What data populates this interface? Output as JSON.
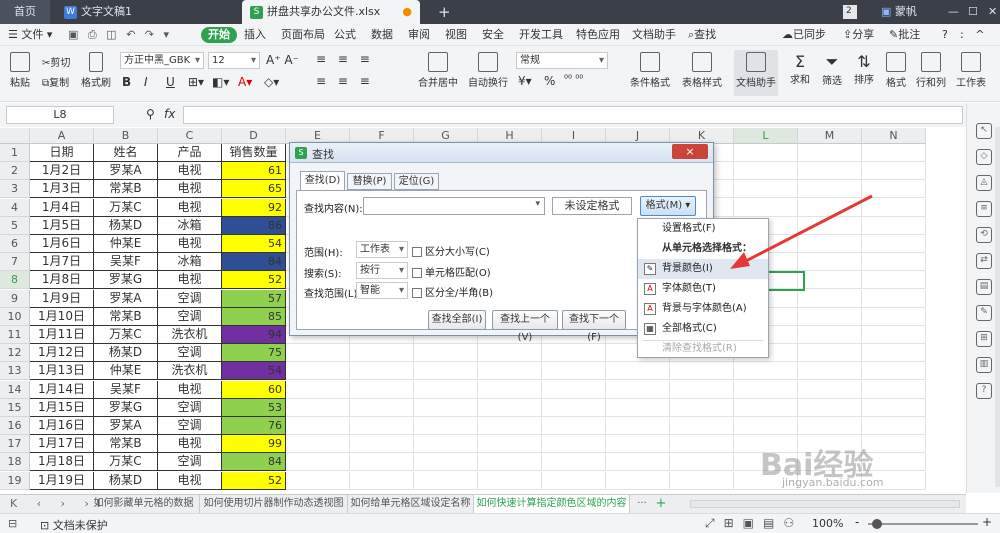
{
  "tabs": {
    "home": "首页",
    "doc1": "文字文稿1",
    "doc2": "拼盘共享办公文件.xlsx",
    "add": "+"
  },
  "topright": {
    "badge": "2",
    "user": "蒙帆"
  },
  "menu": {
    "file": "文件",
    "start": "开始",
    "items": [
      "插入",
      "页面布局",
      "公式",
      "数据",
      "审阅",
      "视图",
      "安全",
      "开发工具",
      "特色应用",
      "文档助手"
    ],
    "search": "查找",
    "sync": "已同步",
    "share": "分享",
    "comment": "批注",
    "help": "?"
  },
  "ribbon": {
    "paste": "粘贴",
    "cut": "剪切",
    "copy": "复制",
    "format_painter": "格式刷",
    "font": "方正中黑_GBK",
    "size": "12",
    "bold": "B",
    "italic": "I",
    "underline": "U",
    "merge": "合并居中",
    "wrap": "自动换行",
    "numfmt": "常规",
    "percent": "%",
    "cond": "条件格式",
    "table_style": "表格样式",
    "doc_helper": "文档助手",
    "sum": "求和",
    "filter": "筛选",
    "sort": "排序",
    "format": "格式",
    "rowcol": "行和列",
    "sheet": "工作表",
    "sigma": "Σ"
  },
  "formula": {
    "cell": "L8",
    "fx": "fx"
  },
  "columns": [
    "A",
    "B",
    "C",
    "D",
    "E",
    "F",
    "G",
    "H",
    "I",
    "J",
    "K",
    "L",
    "M",
    "N"
  ],
  "rows": [
    {
      "n": "1",
      "a": "日期",
      "b": "姓名",
      "c": "产品",
      "d": "销售数量",
      "color": "#ffffff"
    },
    {
      "n": "2",
      "a": "1月2日",
      "b": "罗某A",
      "c": "电视",
      "d": "61",
      "color": "#ffff00"
    },
    {
      "n": "3",
      "a": "1月3日",
      "b": "常某B",
      "c": "电视",
      "d": "65",
      "color": "#ffff00"
    },
    {
      "n": "4",
      "a": "1月4日",
      "b": "万某C",
      "c": "电视",
      "d": "92",
      "color": "#ffff00"
    },
    {
      "n": "5",
      "a": "1月5日",
      "b": "杨某D",
      "c": "冰箱",
      "d": "86",
      "color": "#2e4f95"
    },
    {
      "n": "6",
      "a": "1月6日",
      "b": "仲某E",
      "c": "电视",
      "d": "54",
      "color": "#ffff00"
    },
    {
      "n": "7",
      "a": "1月7日",
      "b": "吴某F",
      "c": "冰箱",
      "d": "84",
      "color": "#2e4f95"
    },
    {
      "n": "8",
      "a": "1月8日",
      "b": "罗某G",
      "c": "电视",
      "d": "52",
      "color": "#ffff00"
    },
    {
      "n": "9",
      "a": "1月9日",
      "b": "罗某A",
      "c": "空调",
      "d": "57",
      "color": "#8fd14f"
    },
    {
      "n": "10",
      "a": "1月10日",
      "b": "常某B",
      "c": "空调",
      "d": "85",
      "color": "#8fd14f"
    },
    {
      "n": "11",
      "a": "1月11日",
      "b": "万某C",
      "c": "洗衣机",
      "d": "94",
      "color": "#7030a0"
    },
    {
      "n": "12",
      "a": "1月12日",
      "b": "杨某D",
      "c": "空调",
      "d": "75",
      "color": "#8fd14f"
    },
    {
      "n": "13",
      "a": "1月13日",
      "b": "仲某E",
      "c": "洗衣机",
      "d": "54",
      "color": "#7030a0"
    },
    {
      "n": "14",
      "a": "1月14日",
      "b": "吴某F",
      "c": "电视",
      "d": "60",
      "color": "#ffff00"
    },
    {
      "n": "15",
      "a": "1月15日",
      "b": "罗某G",
      "c": "空调",
      "d": "53",
      "color": "#8fd14f"
    },
    {
      "n": "16",
      "a": "1月16日",
      "b": "罗某A",
      "c": "空调",
      "d": "76",
      "color": "#8fd14f"
    },
    {
      "n": "17",
      "a": "1月17日",
      "b": "常某B",
      "c": "电视",
      "d": "99",
      "color": "#ffff00"
    },
    {
      "n": "18",
      "a": "1月18日",
      "b": "万某C",
      "c": "空调",
      "d": "84",
      "color": "#8fd14f"
    },
    {
      "n": "19",
      "a": "1月19日",
      "b": "杨某D",
      "c": "电视",
      "d": "52",
      "color": "#ffff00"
    }
  ],
  "sheets": [
    "如何影藏单元格的数据",
    "如何使用切片器制作动态透视图",
    "如何给单元格区域设定名称",
    "如何快速计算指定颜色区域的内容",
    "···",
    "+"
  ],
  "status": {
    "protect": "文档未保护",
    "zoom": "100%",
    "minus": "-",
    "plus": "+"
  },
  "dialog": {
    "title": "查找",
    "tabs": [
      "查找(D)",
      "替换(P)",
      "定位(G)"
    ],
    "find_label": "查找内容(N):",
    "no_format": "未设定格式",
    "format_btn": "格式(M)",
    "scope_label": "范围(H):",
    "scope_val": "工作表",
    "search_label": "搜索(S):",
    "search_val": "按行",
    "range_label": "查找范围(L):",
    "range_val": "智能",
    "case": "区分大小写(C)",
    "whole": "单元格匹配(O)",
    "width": "区分全/半角(B)",
    "find_all": "查找全部(I)",
    "find_prev": "查找上一个(V)",
    "find_next": "查找下一个(F)",
    "close": "×"
  },
  "dropdown": {
    "items": [
      "设置格式(F)",
      "从单元格选择格式：",
      "背景颜色(I)",
      "字体颜色(T)",
      "背景与字体颜色(A)",
      "全部格式(C)",
      "清除查找格式(R)"
    ]
  },
  "watermark": {
    "text": "Bai经验",
    "sub": "jingyan.baidu.com"
  }
}
